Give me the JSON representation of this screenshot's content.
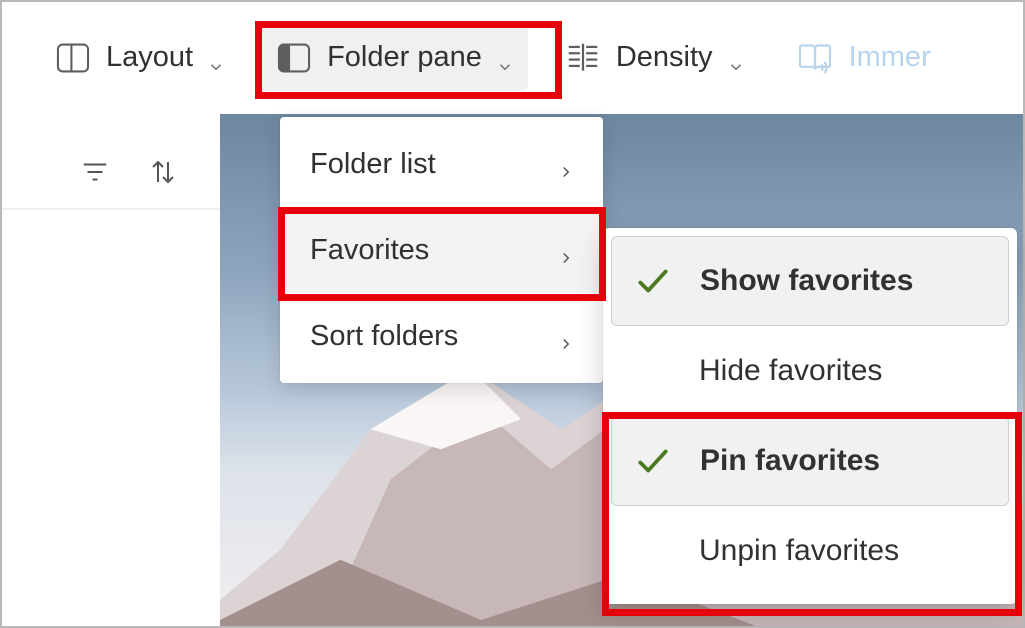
{
  "toolbar": {
    "layout_label": "Layout",
    "folder_pane_label": "Folder pane",
    "density_label": "Density",
    "immersive_label": "Immer"
  },
  "left_panel": {},
  "dropdown": {
    "items": [
      {
        "label": "Folder list"
      },
      {
        "label": "Favorites"
      },
      {
        "label": "Sort folders"
      }
    ]
  },
  "submenu": {
    "items": [
      {
        "label": "Show favorites",
        "checked": true,
        "selected": true
      },
      {
        "label": "Hide favorites",
        "checked": false,
        "selected": false
      },
      {
        "label": "Pin favorites",
        "checked": true,
        "selected": true
      },
      {
        "label": "Unpin favorites",
        "checked": false,
        "selected": false
      }
    ]
  },
  "colors": {
    "highlight": "#e6000b",
    "check": "#4a7a1f",
    "disabled": "#b8d4ec"
  }
}
